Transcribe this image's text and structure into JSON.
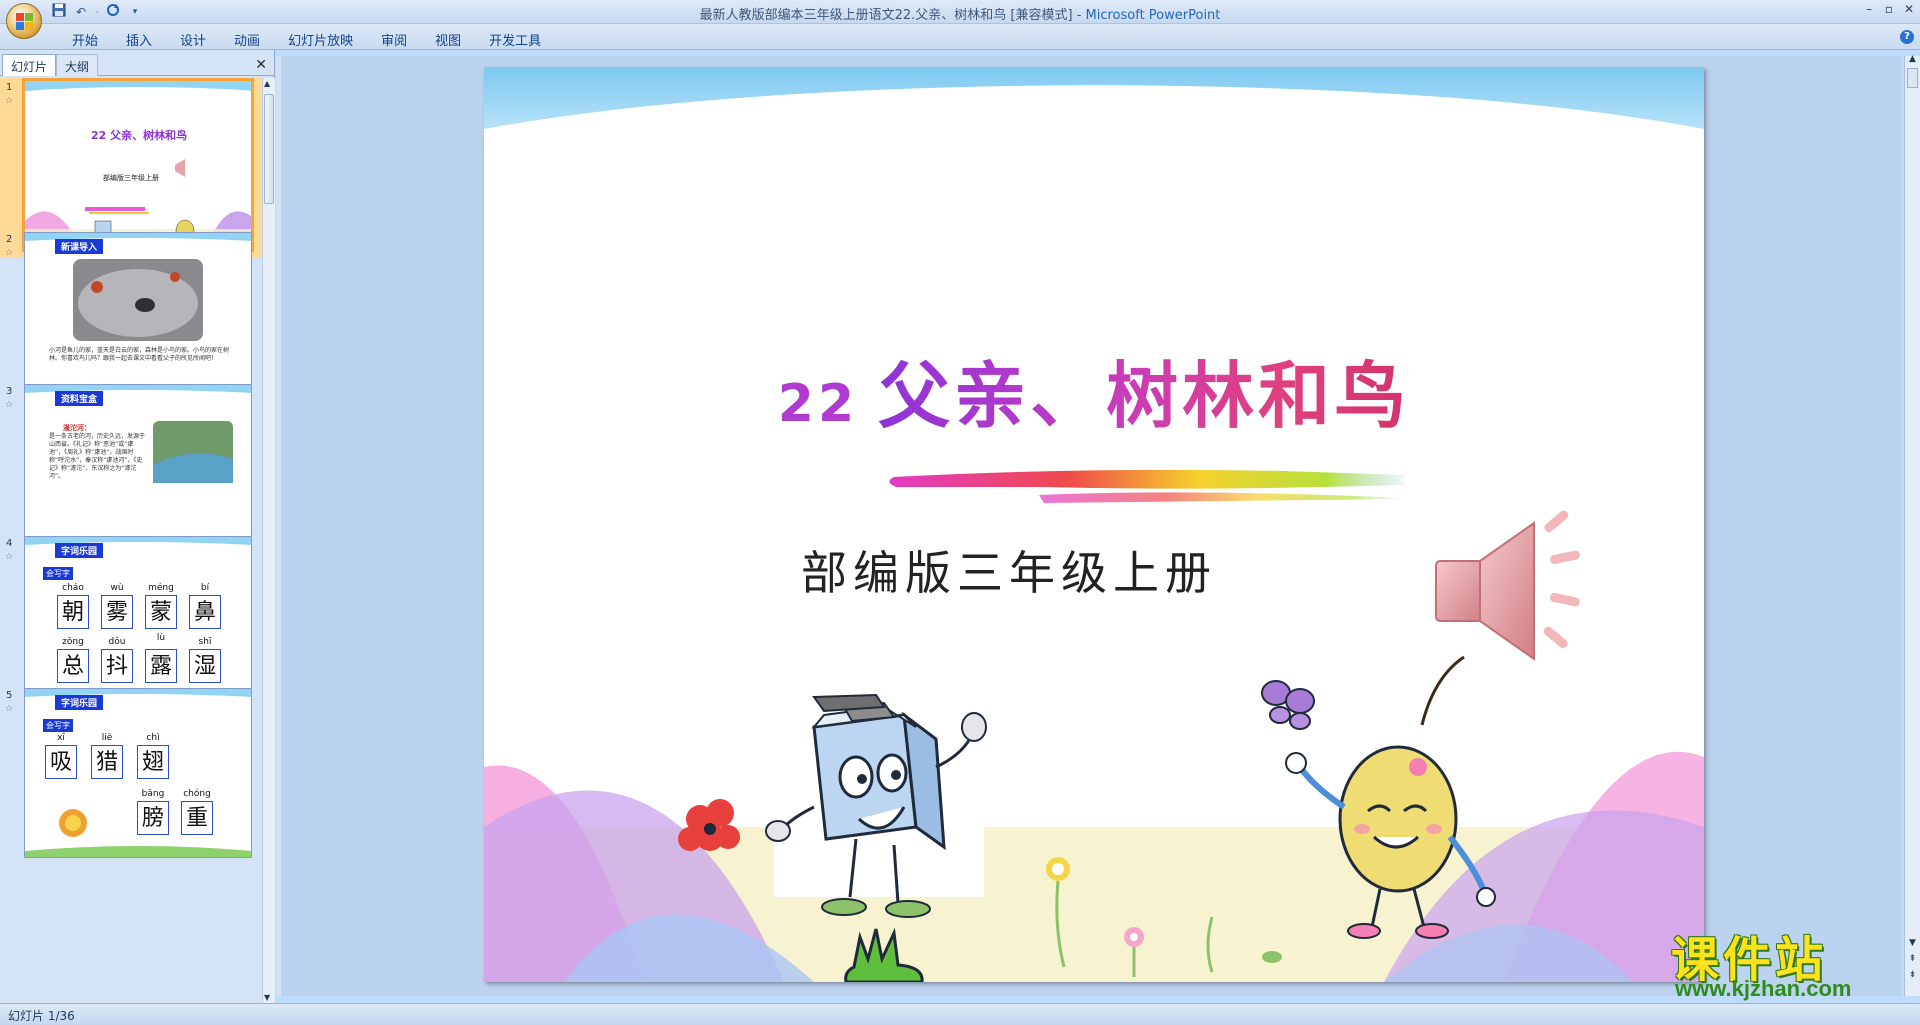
{
  "window": {
    "title": "最新人教版部编本三年级上册语文22.父亲、树林和鸟 [兼容模式] - ",
    "app_name": "Microsoft PowerPoint",
    "controls": [
      "–",
      "▫",
      "✕"
    ]
  },
  "quick_access": [
    "save-icon",
    "undo-icon",
    "redo-icon",
    "customize-icon"
  ],
  "ribbon": {
    "tabs": [
      "开始",
      "插入",
      "设计",
      "动画",
      "幻灯片放映",
      "审阅",
      "视图",
      "开发工具"
    ],
    "help": "?"
  },
  "left_pane": {
    "tab_slides": "幻灯片",
    "tab_outline": "大纲",
    "close": "✕",
    "thumbnails": [
      {
        "num": "1",
        "title": "22 父亲、树林和鸟",
        "subtitle": "部编版三年级上册"
      },
      {
        "num": "2",
        "badge": "新课导入",
        "text": "小河是鱼儿的家，蓝天是白云的家，森林是小鸟的家。小鸟的家在树林。你喜欢鸟儿吗？跟我一起去课文中看看父子的所见所闻吧！"
      },
      {
        "num": "3",
        "badge": "资料宝盒",
        "highlight": "滏沱河：",
        "text": "是一条古老的河，历史久远，发源于山西省。《礼记》称“恶池”或“虖池”，《周礼》称“虖池”，战国时称“呼沱水”，秦汉称“虖池河”，《史记》称“滹沱”，东汉称之为“滹沱河”。"
      },
      {
        "num": "4",
        "badge": "字词乐园",
        "tag": "会写字",
        "chars": [
          {
            "py": "cháo",
            "ch": "朝"
          },
          {
            "py": "wù",
            "ch": "雾"
          },
          {
            "py": "méng",
            "ch": "蒙"
          },
          {
            "py": "bí",
            "ch": "鼻"
          },
          {
            "py": "zǒng",
            "ch": "总"
          },
          {
            "py": "dǒu",
            "ch": "抖"
          },
          {
            "py": "lù",
            "ch": "露"
          },
          {
            "py": "shī",
            "ch": "湿"
          }
        ]
      },
      {
        "num": "5",
        "badge": "字词乐园",
        "tag": "会写字",
        "chars": [
          {
            "py": "xī",
            "ch": "吸"
          },
          {
            "py": "liè",
            "ch": "猎"
          },
          {
            "py": "chì",
            "ch": "翅"
          },
          {
            "py": "bǎng",
            "ch": "膀"
          },
          {
            "py": "chóng",
            "ch": "重"
          }
        ]
      }
    ]
  },
  "slide": {
    "number": "22",
    "title": "父亲、树林和鸟",
    "subtitle": "部编版三年级上册"
  },
  "status": {
    "text": "幻灯片 1/36"
  },
  "watermark": {
    "cn": "课件站",
    "url": "www.kjzhan.com"
  },
  "colors": {
    "accent": "#8e34d6",
    "ribbon": "#c9dbf0",
    "selected_border": "#f8a23a",
    "badge": "#1a3ad6"
  }
}
